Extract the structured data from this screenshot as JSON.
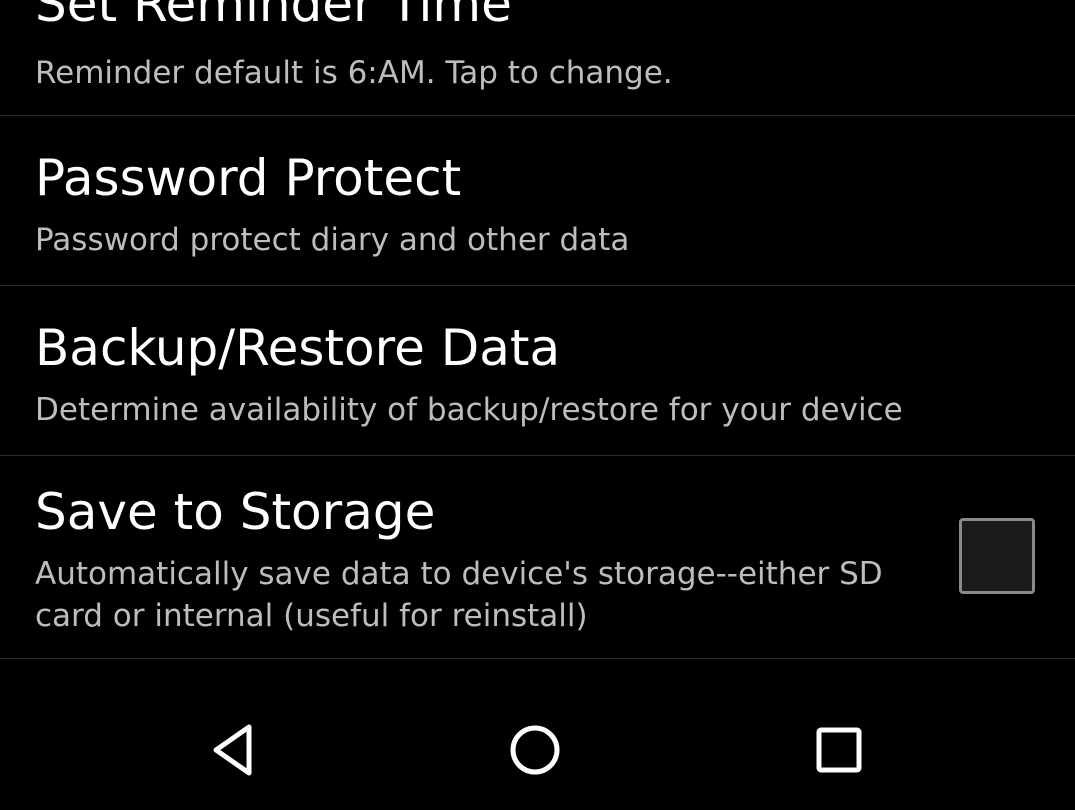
{
  "preferences": [
    {
      "title": "Set Reminder Time",
      "summary": "Reminder default is 6:AM. Tap to change."
    },
    {
      "title": "Password Protect",
      "summary": "Password protect diary and other data"
    },
    {
      "title": "Backup/Restore Data",
      "summary": "Determine availability of backup/restore for your device"
    },
    {
      "title": "Save to Storage",
      "summary": "Automatically save data to device's storage--either SD card or internal (useful for reinstall)",
      "checked": false
    }
  ],
  "navbar": {
    "buttons": [
      "back-icon",
      "home-icon",
      "recents-icon"
    ]
  },
  "colors": {
    "background": "#000000",
    "title": "#ffffff",
    "summary": "#bdbdbd",
    "divider": "#2c2c2c",
    "checkbox_border": "#8a8a8a"
  }
}
